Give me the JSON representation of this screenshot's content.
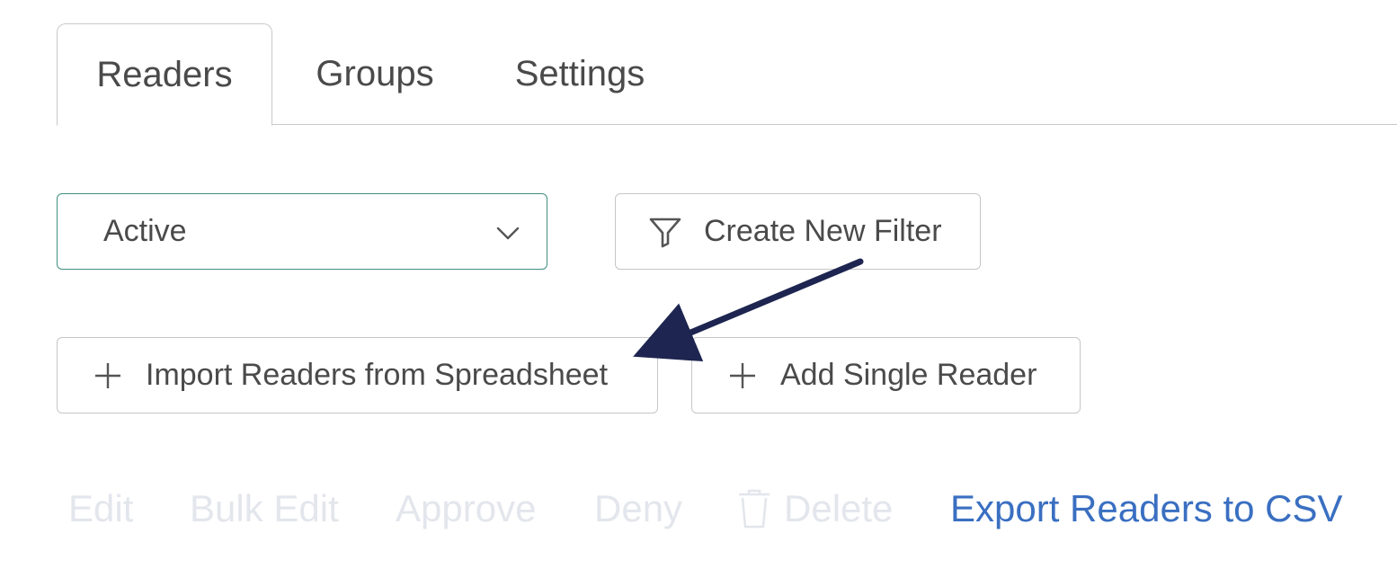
{
  "tabs": [
    {
      "label": "Readers",
      "active": true
    },
    {
      "label": "Groups",
      "active": false
    },
    {
      "label": "Settings",
      "active": false
    }
  ],
  "filters": {
    "status_select": {
      "value": "Active",
      "icon": "chevron-down-icon"
    },
    "create_filter": {
      "label": "Create New Filter",
      "icon": "filter-funnel-icon"
    }
  },
  "add_buttons": {
    "import": {
      "label": "Import Readers from Spreadsheet",
      "icon": "plus-icon"
    },
    "add_single": {
      "label": "Add Single Reader",
      "icon": "plus-icon"
    }
  },
  "actions": {
    "edit": "Edit",
    "bulk_edit": "Bulk Edit",
    "approve": "Approve",
    "deny": "Deny",
    "delete": "Delete",
    "export": "Export Readers to CSV"
  },
  "colors": {
    "select_border": "#3f8f7f",
    "link": "#3a6fc1",
    "disabled_text": "#e3e6ec",
    "annotation_arrow": "#1d2550"
  }
}
